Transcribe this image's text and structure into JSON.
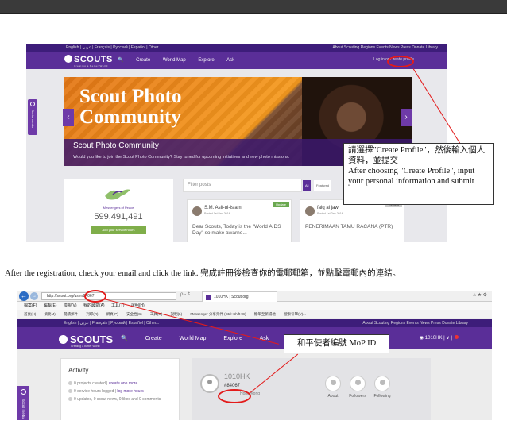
{
  "shot1": {
    "lang_links": "English | عربي | Français | Русский | Español | Other...",
    "top_links": "About Scouting  Regions  Events  News  Press  Donate  Library",
    "logo": "SCOUTS",
    "logo_sub": "Creating a Better World",
    "nav": [
      "Create",
      "World Map",
      "Explore",
      "Ask"
    ],
    "login": "Log in or",
    "create_profile": "Create profile",
    "side_tab": "Social media",
    "hero_title_line1": "Scout Photo",
    "hero_title_line2": "Community",
    "hero_heading": "Scout Photo Community",
    "hero_text": "Would you like to join the Scout Photo Community? Stay tuned for upcoming initiatives and new photo missions.",
    "mop_label": "Messengers of Peace",
    "service_hours": "599,491,491",
    "add_hours_button": "Add your service hours",
    "search_placeholder": "Filter posts",
    "filter_all": "All",
    "filter_featured": "Featured",
    "filter_more": "W",
    "posts": [
      {
        "name": "S.M. Asif-ul-Islam",
        "date": "Posted 1st Dec 2014",
        "tag": "Update",
        "body": "Dear Scouts, Today is the \"World AIDS Day\" so make awarne..."
      },
      {
        "name": "faiq al jawi",
        "date": "Posted 1st Dec 2014",
        "tag": "Review",
        "body": "PENERIMAAN TAMU RACANA (PTR)"
      }
    ]
  },
  "callout1": {
    "zh": "請選擇\"Create Profile\"，然後輸入個人資料，並提交",
    "en": "After choosing \"Create Profile\", input your personal information and submit"
  },
  "paragraph": "After the registration, check your email and click the link.  完成註冊後檢查你的電郵郵箱，並點擊電郵內的連結。",
  "shot2": {
    "url": "http://scout.org/user/84067",
    "search_hint": "ρ - ¢",
    "tab_title": "1010HK | Scout.org",
    "window_controls": "⌂ ★ ⚙",
    "menu": [
      "檔案(F)",
      "編輯(E)",
      "檢視(V)",
      "我的最愛(A)",
      "工具(T)",
      "說明(H)"
    ],
    "favorites": [
      "首頁(H)",
      "摘要(J)",
      "閱讀郵件",
      "列印(R)",
      "網頁(P)",
      "安全性(S)",
      "工具(O)",
      "說明(L)",
      "Messenger 分享元件 (Ctrl+Shift+C)",
      "豬年至新場地",
      "搜索引擎(V)..."
    ],
    "lang_links": "English | عربي | Français | Русский | Español | Other...",
    "top_links": "About Scouting  Regions  Events  News  Press  Donate  Library",
    "logo": "SCOUTS",
    "logo_sub": "Creating a Better World",
    "nav": [
      "Create",
      "World Map",
      "Explore",
      "Ask"
    ],
    "user": "1010HK | ∨ |",
    "side_tab": "Social media",
    "activity_title": "Activity",
    "activity_rows": [
      {
        "text": "0 projects created | ",
        "link": "create one more"
      },
      {
        "text": "0 service hours logged | ",
        "link": "log more hours"
      },
      {
        "text": "0 updates, 0 scout news, 0 likes and 0 comments",
        "link": ""
      }
    ],
    "profile_name": "1010HK",
    "mop_id": "#84067",
    "location": "Hong Kong",
    "profile_links": [
      "About",
      "Followers",
      "Following"
    ]
  },
  "callout2": "和平使者編號 MoP ID"
}
